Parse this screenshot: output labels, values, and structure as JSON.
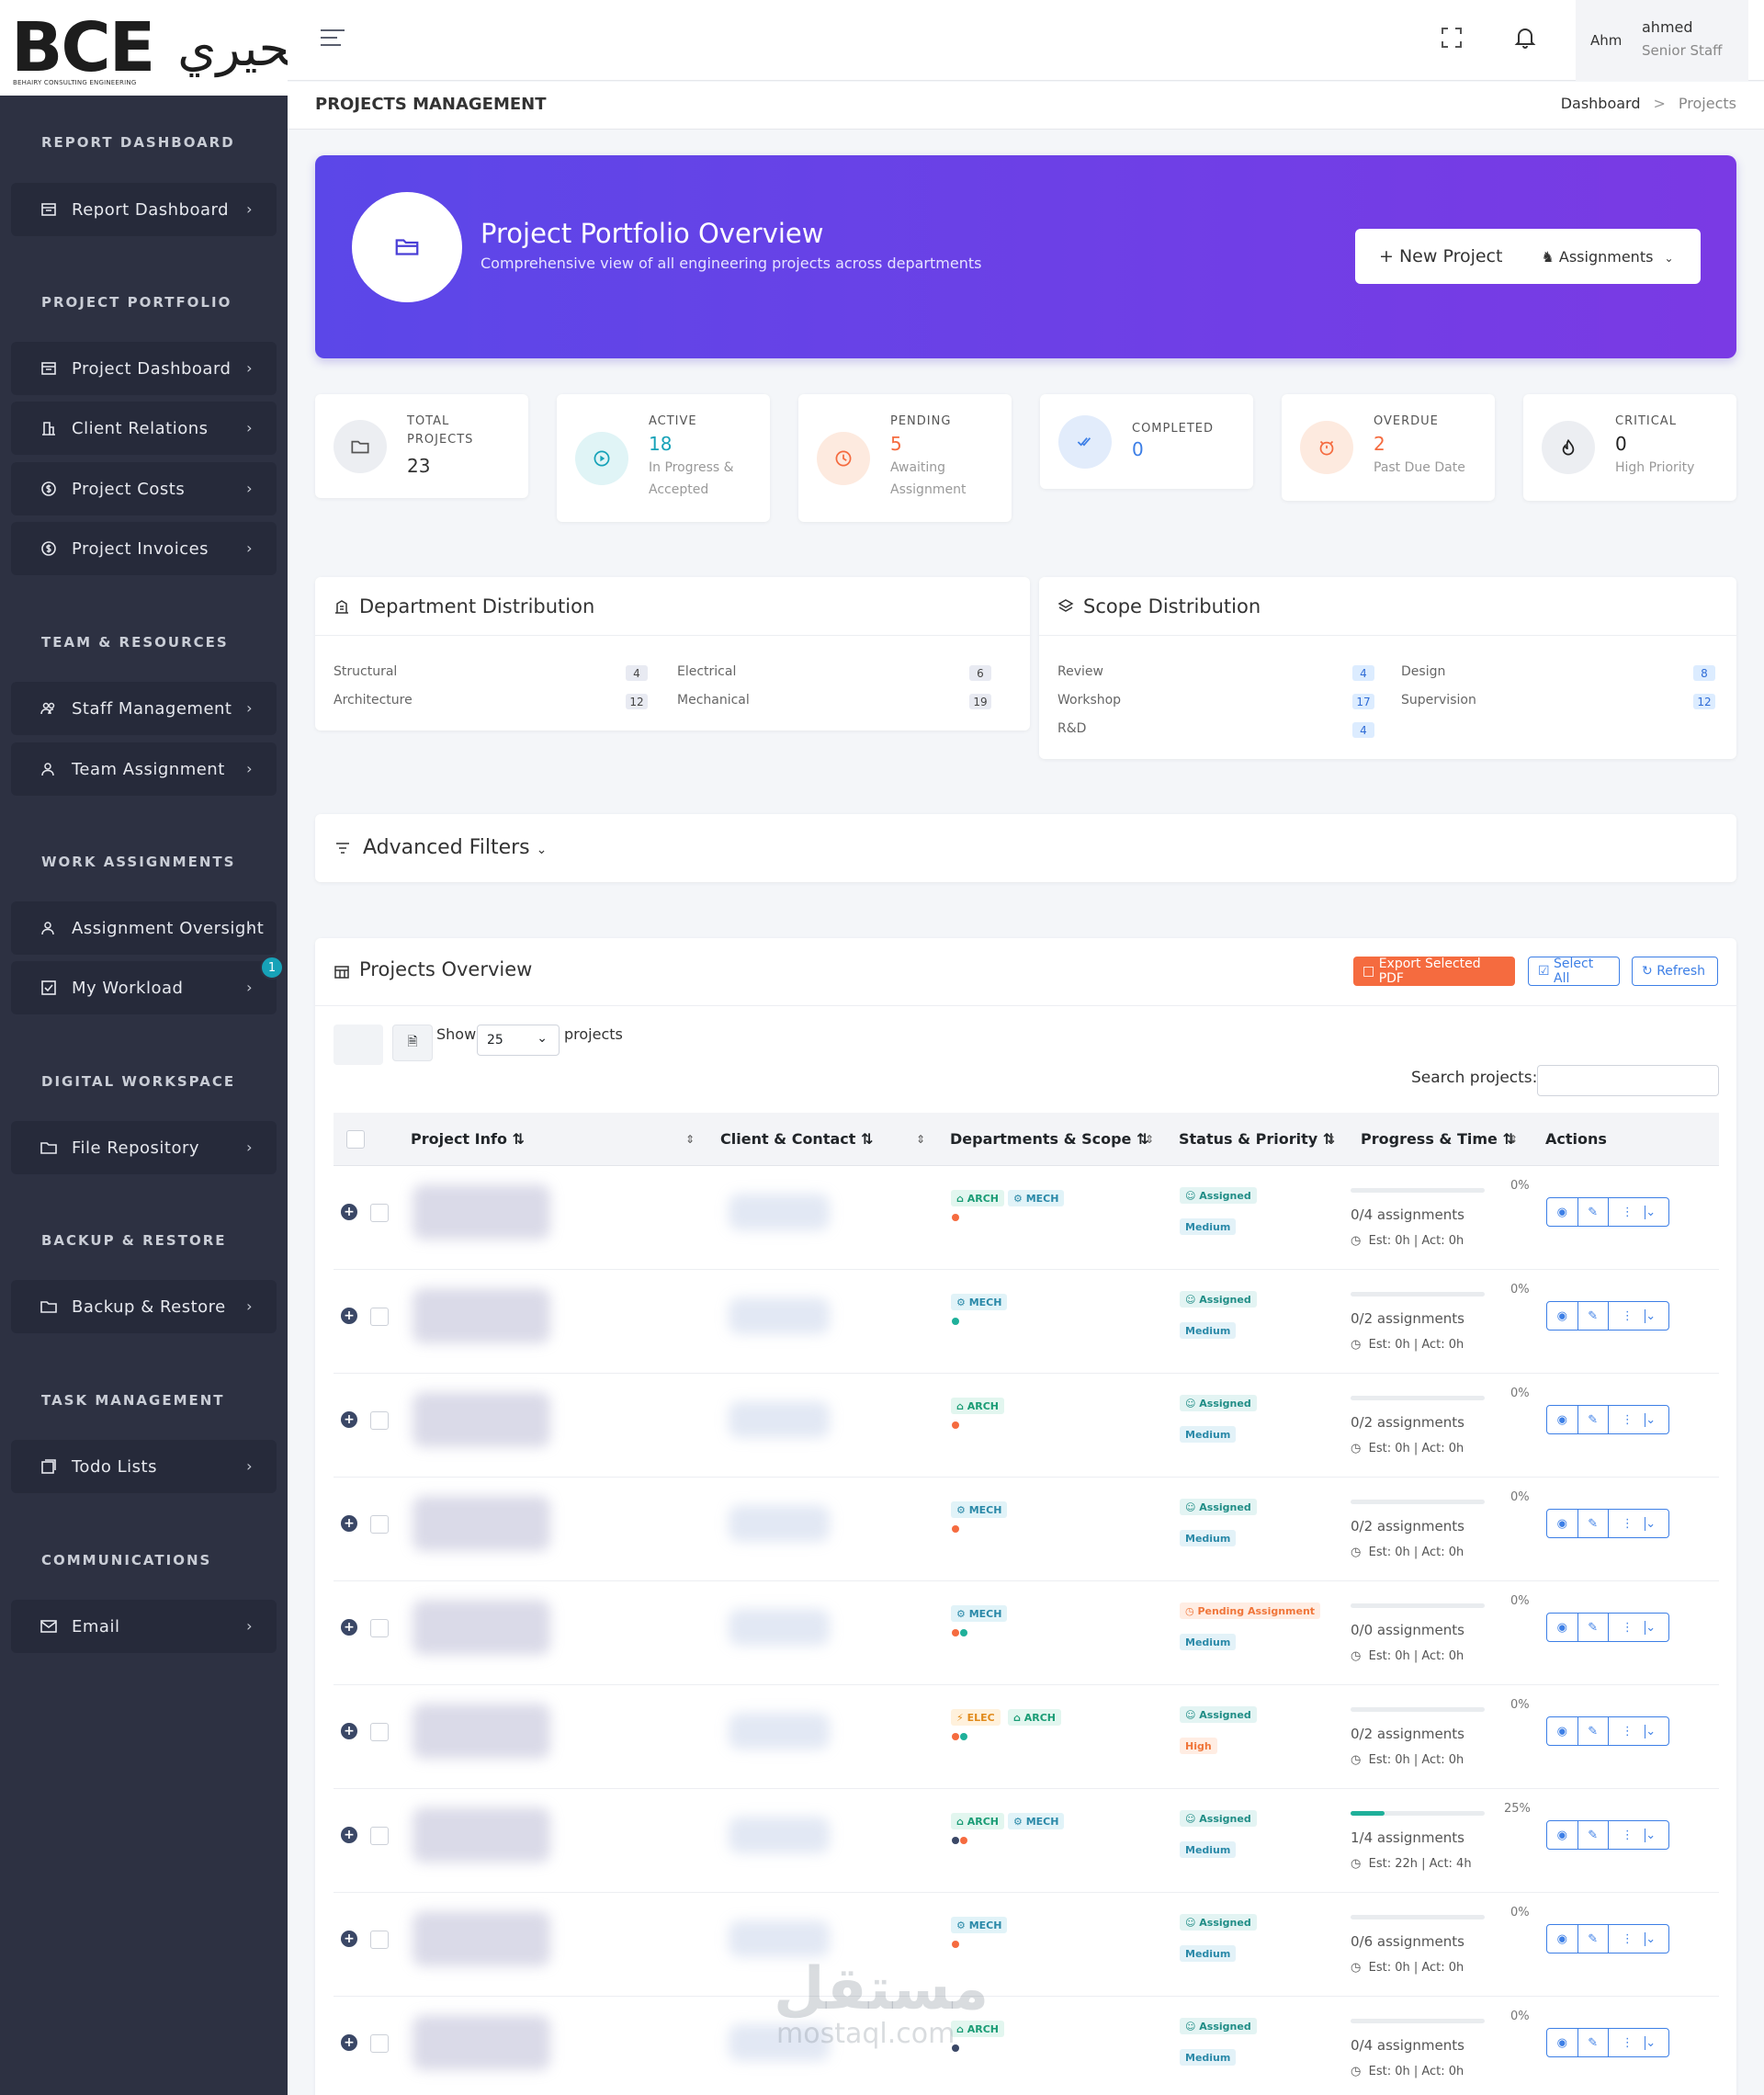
{
  "brand": {
    "logo_text": "BCE",
    "logo_subtitle": "BEHAIRY CONSULTING ENGINEERING",
    "logo_arabic": "البحيري"
  },
  "sidebar": {
    "sections": [
      {
        "title": "REPORT DASHBOARD",
        "items": [
          {
            "label": "Report Dashboard",
            "icon": "report-icon"
          }
        ]
      },
      {
        "title": "PROJECT PORTFOLIO",
        "items": [
          {
            "label": "Project Dashboard",
            "icon": "dashboard-icon"
          },
          {
            "label": "Client Relations",
            "icon": "building-icon"
          },
          {
            "label": "Project Costs",
            "icon": "dollar-icon"
          },
          {
            "label": "Project Invoices",
            "icon": "dollar-icon"
          }
        ]
      },
      {
        "title": "TEAM & RESOURCES",
        "items": [
          {
            "label": "Staff Management",
            "icon": "people-icon"
          },
          {
            "label": "Team Assignment",
            "icon": "user-icon"
          }
        ]
      },
      {
        "title": "WORK ASSIGNMENTS",
        "items": [
          {
            "label": "Assignment Oversight",
            "icon": "user-icon"
          },
          {
            "label": "My Workload",
            "icon": "checkbox-icon",
            "badge": "1"
          }
        ]
      },
      {
        "title": "DIGITAL WORKSPACE",
        "items": [
          {
            "label": "File Repository",
            "icon": "folder-icon"
          }
        ]
      },
      {
        "title": "BACKUP & RESTORE",
        "items": [
          {
            "label": "Backup & Restore",
            "icon": "folder-icon"
          }
        ]
      },
      {
        "title": "TASK MANAGEMENT",
        "items": [
          {
            "label": "Todo Lists",
            "icon": "list-icon"
          }
        ]
      },
      {
        "title": "COMMUNICATIONS",
        "items": [
          {
            "label": "Email",
            "icon": "mail-icon"
          }
        ]
      }
    ]
  },
  "topbar": {
    "avatar_alt": "Ahm",
    "user_name": "ahmed",
    "user_role": "Senior Staff"
  },
  "subbar": {
    "title": "PROJECTS MANAGEMENT",
    "crumb_home": "Dashboard",
    "crumb_sep": ">",
    "crumb_current": "Projects"
  },
  "hero": {
    "title": "Project Portfolio Overview",
    "subtitle": "Comprehensive view of all engineering projects across departments",
    "new_project": "+ New Project",
    "assignments": "Assignments"
  },
  "stats": [
    {
      "label": "TOTAL PROJECTS",
      "value": "23",
      "sub": "",
      "color": "#333333"
    },
    {
      "label": "ACTIVE",
      "value": "18",
      "sub": "In Progress & Accepted",
      "color": "#17a2b8"
    },
    {
      "label": "PENDING",
      "value": "5",
      "sub": "Awaiting Assignment",
      "color": "#f56b3f"
    },
    {
      "label": "COMPLETED",
      "value": "0",
      "sub": "",
      "color": "#3d7fe6"
    },
    {
      "label": "OVERDUE",
      "value": "2",
      "sub": "Past Due Date",
      "color": "#f56b3f"
    },
    {
      "label": "CRITICAL",
      "value": "0",
      "sub": "High Priority",
      "color": "#222222"
    }
  ],
  "department_distribution": {
    "title": "Department Distribution",
    "items": [
      {
        "label": "Structural",
        "count": "4"
      },
      {
        "label": "Electrical",
        "count": "6"
      },
      {
        "label": "Architecture",
        "count": "12"
      },
      {
        "label": "Mechanical",
        "count": "19"
      }
    ]
  },
  "scope_distribution": {
    "title": "Scope Distribution",
    "items": [
      {
        "label": "Review",
        "count": "4"
      },
      {
        "label": "Design",
        "count": "8"
      },
      {
        "label": "Workshop",
        "count": "17"
      },
      {
        "label": "Supervision",
        "count": "12"
      },
      {
        "label": "R&D",
        "count": "4"
      }
    ]
  },
  "filters": {
    "title": "Advanced Filters"
  },
  "projects": {
    "title": "Projects Overview",
    "export_btn": "Export Selected PDF",
    "select_all_btn": "Select All",
    "refresh_btn": "Refresh",
    "show_label": "Show",
    "page_size": "25",
    "projects_label": "projects",
    "search_label": "Search projects:",
    "columns": [
      "Project Info ⇅",
      "Client & Contact ⇅",
      "Departments & Scope ⇅",
      "Status & Priority ⇅",
      "Progress & Time ⇅",
      "Actions"
    ],
    "rows": [
      {
        "depts": [
          "ARCH",
          "MECH"
        ],
        "dots": [
          "#f56b3f"
        ],
        "status": "Assigned",
        "priority": "Medium",
        "pct": "0%",
        "progress": 0,
        "assignments": "0/4 assignments",
        "time": "Est: 0h | Act: 0h"
      },
      {
        "depts": [
          "MECH"
        ],
        "dots": [
          "#1fb09a"
        ],
        "status": "Assigned",
        "priority": "Medium",
        "pct": "0%",
        "progress": 0,
        "assignments": "0/2 assignments",
        "time": "Est: 0h | Act: 0h"
      },
      {
        "depts": [
          "ARCH"
        ],
        "dots": [
          "#f56b3f"
        ],
        "status": "Assigned",
        "priority": "Medium",
        "pct": "0%",
        "progress": 0,
        "assignments": "0/2 assignments",
        "time": "Est: 0h | Act: 0h"
      },
      {
        "depts": [
          "MECH"
        ],
        "dots": [
          "#f56b3f"
        ],
        "status": "Assigned",
        "priority": "Medium",
        "pct": "0%",
        "progress": 0,
        "assignments": "0/2 assignments",
        "time": "Est: 0h | Act: 0h"
      },
      {
        "depts": [
          "MECH"
        ],
        "dots": [
          "#f56b3f",
          "#1fb09a"
        ],
        "status": "Pending Assignment",
        "priority": "Medium",
        "pct": "0%",
        "progress": 0,
        "assignments": "0/0 assignments",
        "time": "Est: 0h | Act: 0h"
      },
      {
        "depts": [
          "ELEC",
          "ARCH"
        ],
        "dots": [
          "#f56b3f",
          "#1fb09a"
        ],
        "status": "Assigned",
        "priority": "High",
        "pct": "0%",
        "progress": 0,
        "assignments": "0/2 assignments",
        "time": "Est: 0h | Act: 0h"
      },
      {
        "depts": [
          "ARCH",
          "MECH"
        ],
        "dots": [
          "#3a4766",
          "#f56b3f"
        ],
        "status": "Assigned",
        "priority": "Medium",
        "pct": "25%",
        "progress": 0.25,
        "assignments": "1/4 assignments",
        "time": "Est: 22h | Act: 4h"
      },
      {
        "depts": [
          "MECH"
        ],
        "dots": [
          "#f56b3f"
        ],
        "status": "Assigned",
        "priority": "Medium",
        "pct": "0%",
        "progress": 0,
        "assignments": "0/6 assignments",
        "time": "Est: 0h | Act: 0h"
      },
      {
        "depts": [
          "ARCH"
        ],
        "dots": [
          "#3a4766"
        ],
        "status": "Assigned",
        "priority": "Medium",
        "pct": "0%",
        "progress": 0,
        "assignments": "0/4 assignments",
        "time": "Est: 0h | Act: 0h"
      }
    ]
  },
  "watermark": {
    "arabic": "مستقل",
    "latin": "mostaql.com"
  }
}
